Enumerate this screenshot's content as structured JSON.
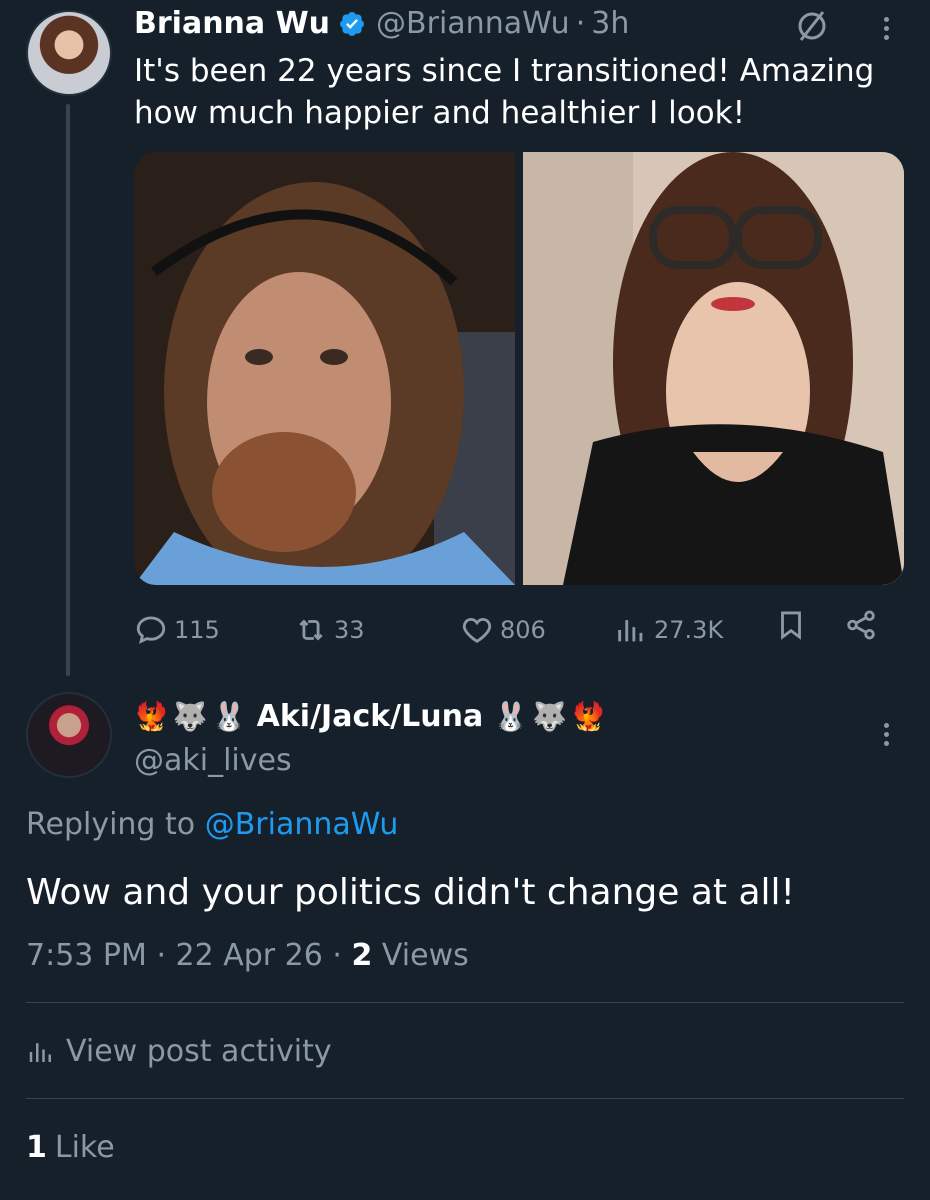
{
  "colors": {
    "background": "#15202b",
    "text_primary": "#ffffff",
    "text_secondary": "#8b98a5",
    "link": "#1d9bf0",
    "verified": "#1d9bf0",
    "divider": "#38444d"
  },
  "parent_tweet": {
    "author_name": "Brianna Wu",
    "handle": "@BriannaWu",
    "separator": "·",
    "time": "3h",
    "text": "It's been 22 years since I transitioned! Amazing how much happier and healthier I look!",
    "icons": [
      "verified-badge-icon",
      "grok-icon",
      "more-icon"
    ],
    "media": [
      "photo-left",
      "photo-right"
    ],
    "stats": {
      "replies": "115",
      "reposts": "33",
      "likes": "806",
      "views": "27.3K"
    }
  },
  "reply": {
    "emoji_prefix": [
      "🐦‍🔥",
      "🐺",
      "🐰"
    ],
    "author_name": "Aki/Jack/Luna",
    "emoji_suffix": [
      "🐰",
      "🐺",
      "🐦‍🔥"
    ],
    "handle": "@aki_lives",
    "replying_prefix": "Replying to",
    "replying_to": "@BriannaWu",
    "text": "Wow and your politics didn't change at all!",
    "time": "7:53 PM",
    "date": "22 Apr 26",
    "separator": "·",
    "views_count": "2",
    "views_label": "Views",
    "activity_label": "View post activity",
    "likes_count": "1",
    "likes_label": "Like"
  }
}
